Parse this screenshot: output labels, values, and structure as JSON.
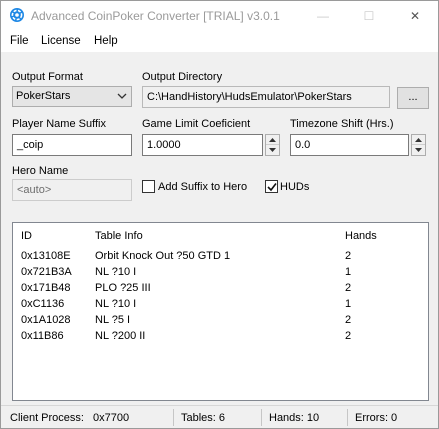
{
  "window": {
    "title": "Advanced CoinPoker Converter [TRIAL] v3.0.1",
    "minimize_glyph": "—",
    "maximize_glyph": "☐",
    "close_glyph": "✕"
  },
  "menu": {
    "file": "File",
    "license": "License",
    "help": "Help"
  },
  "form": {
    "output_format_label": "Output Format",
    "output_format_value": "PokerStars",
    "output_directory_label": "Output Directory",
    "output_directory_value": "C:\\HandHistory\\HudsEmulator\\PokerStars",
    "browse_label": "...",
    "player_suffix_label": "Player Name Suffix",
    "player_suffix_value": "_coip",
    "game_limit_label": "Game Limit Coeficient",
    "game_limit_value": "1.0000",
    "timezone_label": "Timezone Shift (Hrs.)",
    "timezone_value": "0.0",
    "hero_name_label": "Hero Name",
    "hero_name_value": "<auto>",
    "add_suffix_label": "Add Suffix to Hero",
    "add_suffix_checked": false,
    "huds_label": "HUDs",
    "huds_checked": true
  },
  "table": {
    "headers": {
      "id": "ID",
      "info": "Table Info",
      "hands": "Hands"
    },
    "rows": [
      {
        "id": "0x13108E",
        "info": "Orbit Knock Out ?50 GTD 1",
        "hands": "2"
      },
      {
        "id": "0x721B3A",
        "info": "NL ?10 I",
        "hands": "1"
      },
      {
        "id": "0x171B48",
        "info": "PLO ?25 III",
        "hands": "2"
      },
      {
        "id": "0xC1136",
        "info": "NL ?10 I",
        "hands": "1"
      },
      {
        "id": "0x1A1028",
        "info": "NL ?5 I",
        "hands": "2"
      },
      {
        "id": "0x11B86",
        "info": "NL ?200 II",
        "hands": "2"
      }
    ]
  },
  "status": {
    "client_process_label": "Client Process:",
    "client_process_value": "0x7700",
    "tables": "Tables: 6",
    "hands": "Hands: 10",
    "errors": "Errors: 0"
  },
  "colors": {
    "window_bg": "#f0f0f0",
    "title_text": "#9a9a9a",
    "icon_blue": "#1e88e5"
  }
}
